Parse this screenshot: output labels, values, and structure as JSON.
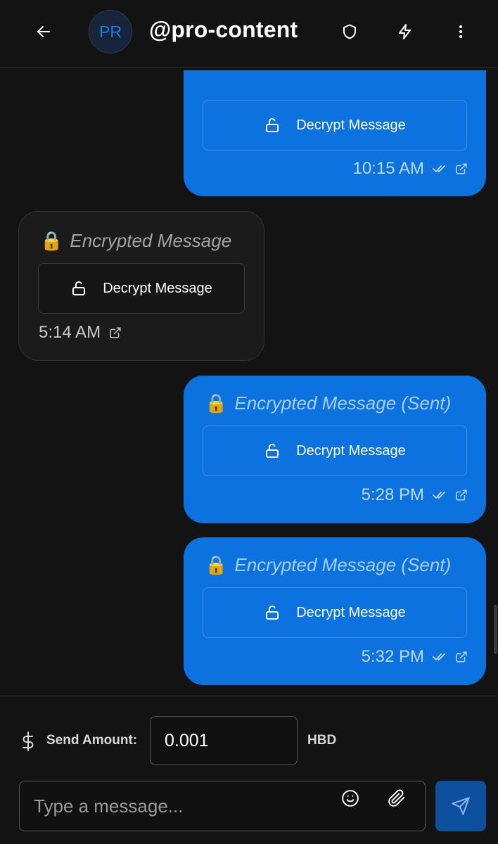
{
  "header": {
    "avatar_initials": "PR",
    "username": "@pro-content",
    "icons": [
      "arrow-left-icon",
      "shield-icon",
      "lightning-icon",
      "more-vertical-icon"
    ]
  },
  "messages": [
    {
      "direction": "sent",
      "title": "",
      "decrypt_label": "Decrypt Message",
      "time": "10:15 AM",
      "read": true
    },
    {
      "direction": "received",
      "title": "Encrypted Message",
      "decrypt_label": "Decrypt Message",
      "time": "5:14 AM",
      "read": false
    },
    {
      "direction": "sent",
      "title": "Encrypted Message (Sent)",
      "decrypt_label": "Decrypt Message",
      "time": "5:28 PM",
      "read": true
    },
    {
      "direction": "sent",
      "title": "Encrypted Message (Sent)",
      "decrypt_label": "Decrypt Message",
      "time": "5:32 PM",
      "read": true
    }
  ],
  "composer": {
    "amount_label": "Send Amount:",
    "amount_value": "0.001",
    "currency": "HBD",
    "message_placeholder": "Type a message..."
  },
  "colors": {
    "background": "#131313",
    "sent_bubble": "#0b72e0",
    "received_bubble": "#1b1b1b",
    "send_button": "#0c4f9c",
    "avatar_text": "#1c7bea"
  }
}
